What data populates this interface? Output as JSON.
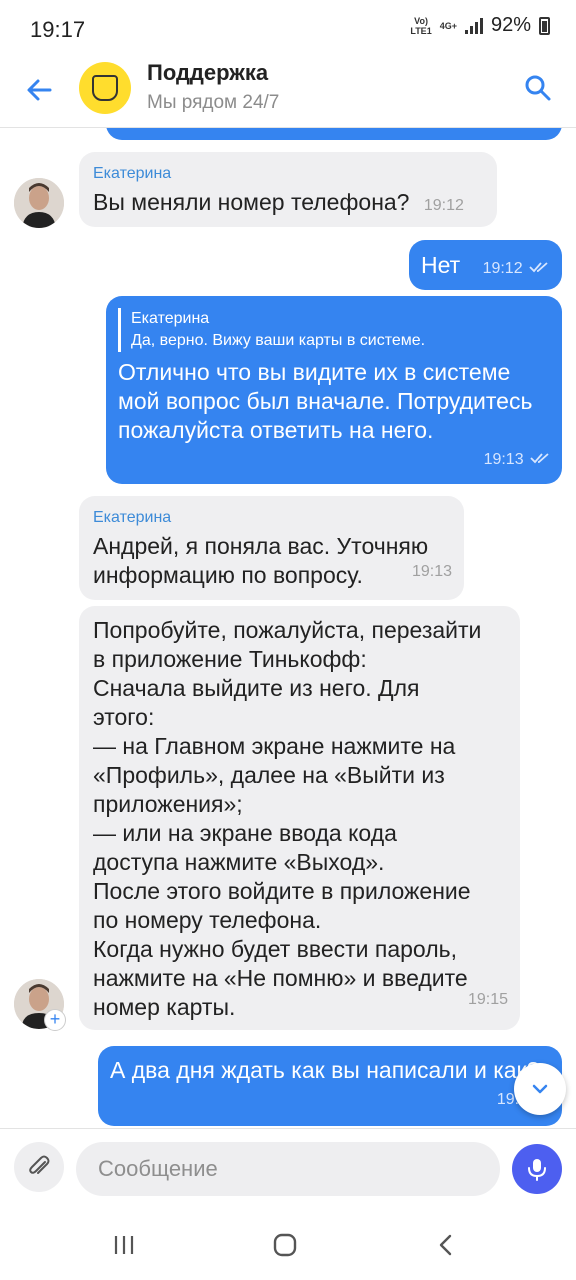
{
  "status": {
    "time": "19:17",
    "volte": "Vo)\nLTE1",
    "network": "4G+",
    "battery": "92%"
  },
  "header": {
    "title": "Поддержка",
    "subtitle": "Мы рядом 24/7"
  },
  "messages": [
    {
      "sender": "Екатерина",
      "text": "Вы меняли номер телефона?",
      "time": "19:12"
    },
    {
      "text": "Нет",
      "time": "19:12"
    },
    {
      "quote_name": "Екатерина",
      "quote_text": "Да, верно. Вижу ваши карты в системе.",
      "text": "Отлично что вы видите их в системе мой вопрос был вначале. Потрудитесь пожалуйста ответить на него.",
      "time": "19:13"
    },
    {
      "sender": "Екатерина",
      "text": "Андрей, я поняла вас. Уточняю информацию по вопросу.",
      "time": "19:13"
    },
    {
      "text_lines": [
        "Попробуйте, пожалуйста, перезайти",
        "в приложение Тинькофф:",
        "Сначала выйдите из него. Для",
        "этого:",
        "— на Главном экране нажмите на",
        "«Профиль», далее на «Выйти из",
        "приложения»;",
        "— или на экране ввода кода",
        "доступа нажмите «Выход».",
        "После этого войдите в приложение",
        "по номеру телефона.",
        "Когда нужно будет ввести пароль,",
        "нажмите на «Не помню» и введите",
        "номер карты."
      ],
      "time": "19:15"
    },
    {
      "text": "А два дня ждать как вы написали и как?",
      "time": "19:1"
    }
  ],
  "composer": {
    "placeholder": "Сообщение"
  },
  "colors": {
    "accent": "#3584f0",
    "incoming": "#efeff1",
    "logo": "#ffdd2d",
    "mic": "#4d5ff0"
  }
}
